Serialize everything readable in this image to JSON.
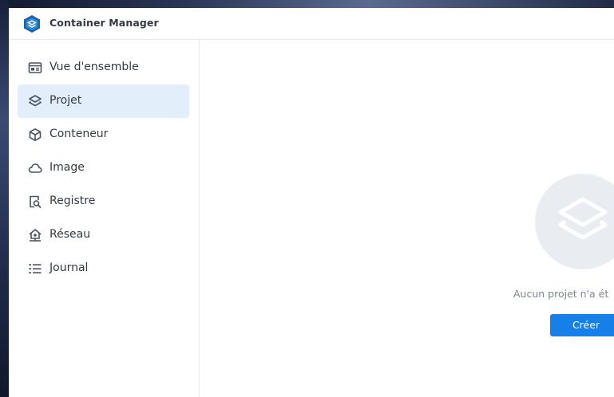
{
  "app": {
    "title": "Container Manager",
    "logo_icon": "container-manager-logo-icon",
    "accent_color": "#1780e8"
  },
  "sidebar": {
    "items": [
      {
        "label": "Vue d'ensemble",
        "icon": "overview-icon",
        "active": false
      },
      {
        "label": "Projet",
        "icon": "layers-icon",
        "active": true
      },
      {
        "label": "Conteneur",
        "icon": "cube-icon",
        "active": false
      },
      {
        "label": "Image",
        "icon": "cloud-icon",
        "active": false
      },
      {
        "label": "Registre",
        "icon": "registry-search-icon",
        "active": false
      },
      {
        "label": "Réseau",
        "icon": "network-home-icon",
        "active": false
      },
      {
        "label": "Journal",
        "icon": "list-icon",
        "active": false
      }
    ],
    "active_background": "#e3eefb"
  },
  "main": {
    "empty_state": {
      "icon": "layers-icon",
      "message": "Aucun projet n'a ét",
      "create_label": "Créer"
    }
  }
}
